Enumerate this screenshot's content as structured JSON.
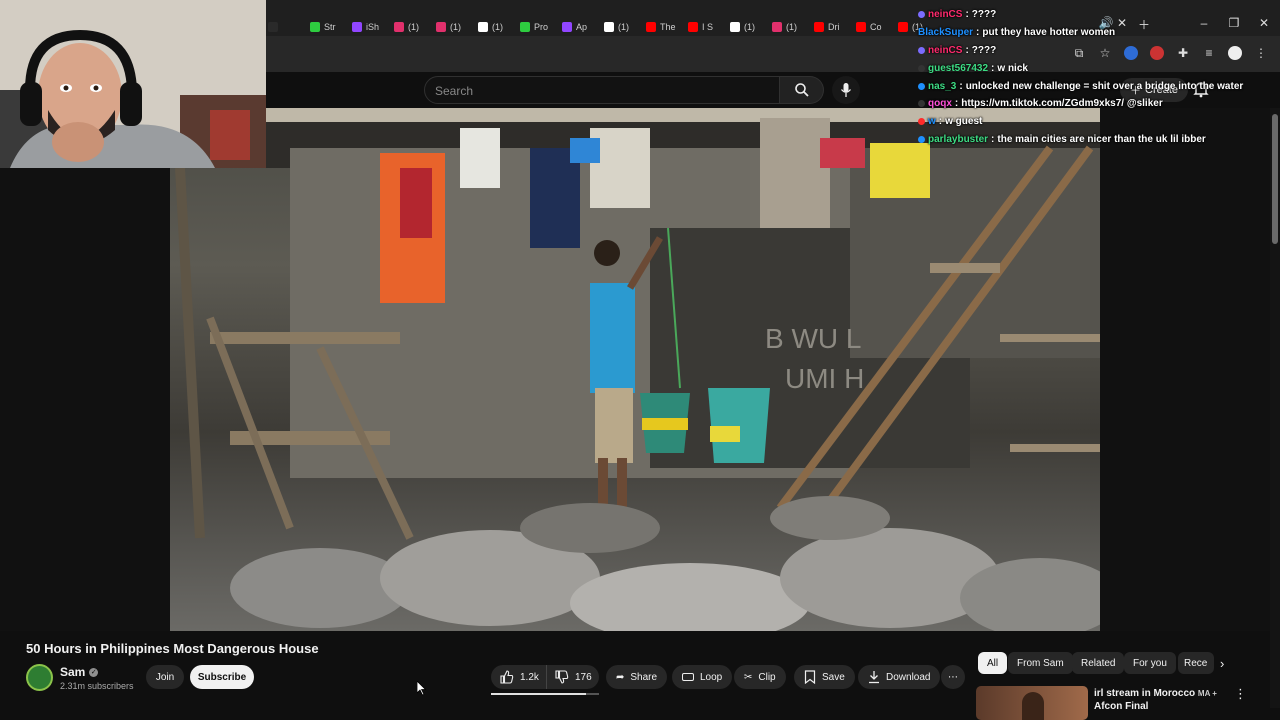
{
  "browser": {
    "tabs": [
      {
        "label": "",
        "color": "#2a2a2a"
      },
      {
        "label": "Str",
        "color": "#2ecc40"
      },
      {
        "label": "iSh",
        "color": "#9146ff"
      },
      {
        "label": "(1)",
        "color": "#e1306c"
      },
      {
        "label": "(1)",
        "color": "#e1306c"
      },
      {
        "label": "(1)",
        "color": "#ffffff"
      },
      {
        "label": "Pro",
        "color": "#2ecc40"
      },
      {
        "label": "Ap",
        "color": "#9146ff"
      },
      {
        "label": "(1)",
        "color": "#ffffff"
      },
      {
        "label": "The",
        "color": "#ff0000"
      },
      {
        "label": "I S",
        "color": "#ff0000"
      },
      {
        "label": "(1)",
        "color": "#ffffff"
      },
      {
        "label": "(1)",
        "color": "#e1306c"
      },
      {
        "label": "Dri",
        "color": "#ff0000"
      },
      {
        "label": "Co",
        "color": "#ff0000"
      },
      {
        "label": "(1)",
        "color": "#ff0000"
      }
    ]
  },
  "youtube": {
    "search_placeholder": "Search",
    "create_label": "Create"
  },
  "chat": [
    {
      "user": "neinCS",
      "msg": "????",
      "color": "#ff2a6d",
      "badge": "#7b6cff"
    },
    {
      "user": "BlackSuper",
      "msg": "put they have hotter women",
      "color": "#1e90ff",
      "badge": ""
    },
    {
      "user": "neinCS",
      "msg": "????",
      "color": "#ff2a6d",
      "badge": "#7b6cff"
    },
    {
      "user": "guest567432",
      "msg": "w nick",
      "color": "#3ddc84",
      "badge": "#333333"
    },
    {
      "user": "nas_3",
      "msg": "unlocked new challenge = shit over a bridge into the water",
      "color": "#3ddc84",
      "badge": "#1e90ff"
    },
    {
      "user": "qoqx",
      "msg": "https://vm.tiktok.com/ZGdm9xks7/ @sliker",
      "color": "#ff4fd8",
      "badge": "#333333"
    },
    {
      "user": "w",
      "msg": "w guest",
      "color": "#1e90ff",
      "badge": "#ff2a2a"
    },
    {
      "user": "parlaybuster",
      "msg": "the main cities are nicer than the uk lil ibber",
      "color": "#3ddc84",
      "badge": "#1e90ff"
    }
  ],
  "video": {
    "title": "50 Hours in Philippines Most Dangerous House",
    "channel": "Sam",
    "subscribers": "2.31m subscribers",
    "join_label": "Join",
    "subscribe_label": "Subscribe",
    "likes": "1.2k",
    "dislikes": "176",
    "like_ratio": 0.88,
    "share_label": "Share",
    "loop_label": "Loop",
    "clip_label": "Clip",
    "save_label": "Save",
    "download_label": "Download"
  },
  "sidebar": {
    "chips": [
      "All",
      "From Sam",
      "Related",
      "For you",
      "Rece"
    ],
    "recommended_title": "irl stream in Morocco",
    "recommended_badge": "MA +",
    "recommended_title_2": "Afcon Final"
  }
}
